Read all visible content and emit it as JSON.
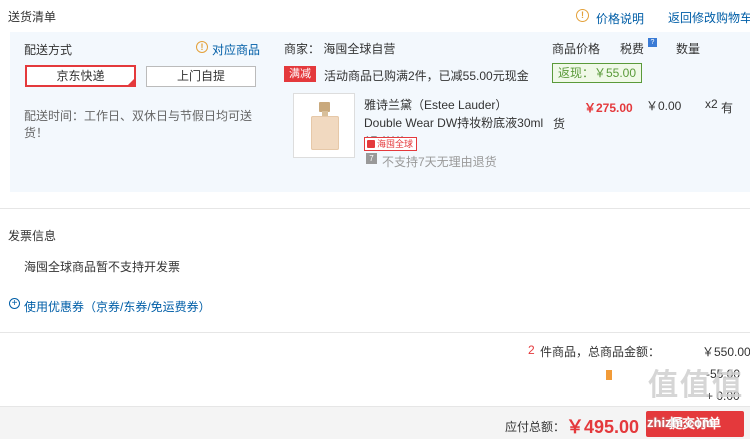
{
  "header": {
    "title": "送货清单",
    "price_explain": "价格说明",
    "back_to_cart": "返回修改购物车"
  },
  "shipping": {
    "title": "配送方式",
    "match_link": "对应商品",
    "options": [
      "京东快递",
      "上门自提"
    ],
    "selected": "京东快递",
    "time_text": "配送时间：工作日、双休日与节假日均可送货！"
  },
  "order": {
    "merchant": "商家：  海囤全球自营",
    "columns": {
      "price": "商品价格",
      "tax": "税费",
      "qty": "数量"
    },
    "promo": {
      "tag": "满减",
      "text": "活动商品已购满2件，已减55.00元现金",
      "cashback": "返现：￥55.00"
    },
    "product": {
      "name": "雅诗兰黛（Estee Lauder）Double Wear DW持妆粉底液30ml 17 1W1",
      "price": "￥275.00",
      "tax": "￥0.00",
      "qty": "x2",
      "stock_a": "有",
      "stock_b": "货",
      "global_tag": "海囤全球",
      "no_return": "不支持7天无理由退货"
    }
  },
  "invoice": {
    "title": "发票信息",
    "text": "海囤全球商品暂不支持开发票"
  },
  "coupon": {
    "label": "使用优惠券（京券/东券/免运费券）"
  },
  "summary": {
    "count": "2",
    "label": " 件商品，总商品金额：",
    "value": "￥550.00",
    "row2_value": "-55.00",
    "row3_value": "+ 0.00"
  },
  "footer": {
    "total_label": "应付总额：",
    "total_value": "￥495.00",
    "submit_label": "提交订单"
  },
  "watermark": {
    "logo": "值值值",
    "site": "zhizhi.com"
  }
}
